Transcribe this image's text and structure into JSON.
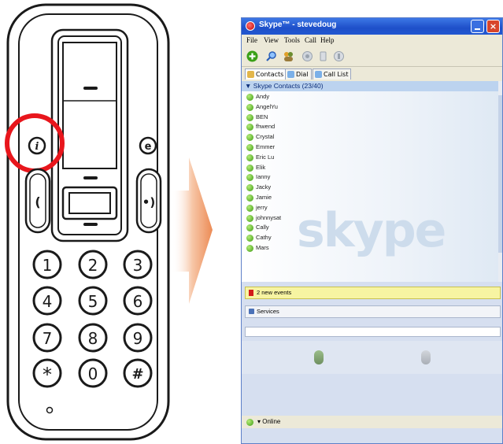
{
  "phone": {
    "info_key": "i",
    "email_key": "e",
    "keypad": [
      "1",
      "2",
      "3",
      "4",
      "5",
      "6",
      "7",
      "8",
      "9",
      "*",
      "0",
      "#"
    ]
  },
  "skype": {
    "title": "Skype™ - stevedoug",
    "menu": [
      "File",
      "View",
      "Tools",
      "Call",
      "Help"
    ],
    "tabs": [
      "Contacts",
      "Dial",
      "Call List"
    ],
    "group_header": "▼ Skype Contacts (23/40)",
    "contacts": [
      "Andy",
      "AngelYu",
      "BEN",
      "fhwend",
      "Crystal",
      "Emmer",
      "Eric Lu",
      "Elik",
      "Ianny",
      "Jacky",
      "Jamie",
      "jerry",
      "johnnysat",
      "Cally",
      "Cathy",
      "Mars"
    ],
    "watermark": "skype",
    "events": "2 new events",
    "services": "Services",
    "status": "Online"
  }
}
